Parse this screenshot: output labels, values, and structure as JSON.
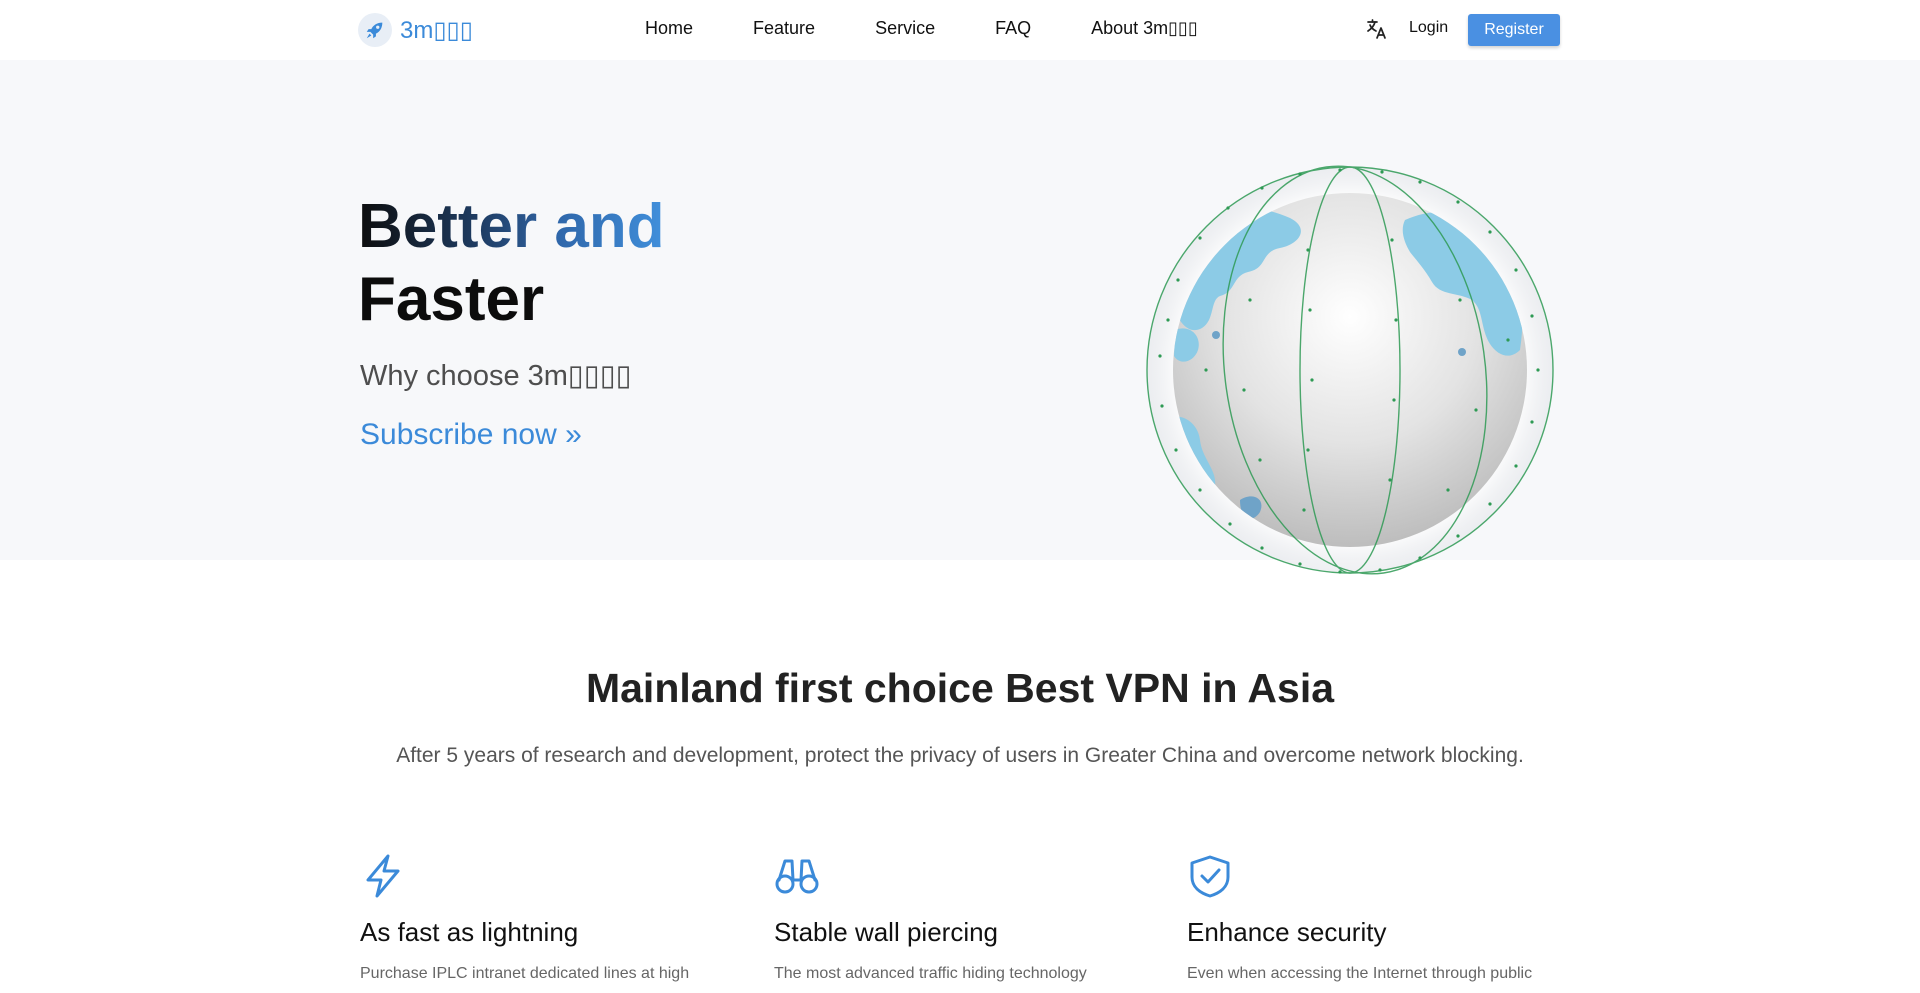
{
  "nav": {
    "brand": "3m▯▯▯",
    "logo_icon": "rocket-icon",
    "items": [
      {
        "label": "Home"
      },
      {
        "label": "Feature"
      },
      {
        "label": "Service"
      },
      {
        "label": "FAQ"
      },
      {
        "label": "About 3m▯▯▯"
      }
    ],
    "translate_icon": "translate-icon",
    "login_label": "Login",
    "register_label": "Register"
  },
  "hero": {
    "title_word1": "Better",
    "title_word2": "and",
    "title_line2": "Faster",
    "subtitle": "Why choose 3m▯▯▯▯",
    "cta_label": "Subscribe now »",
    "image": "globe-illustration"
  },
  "intro": {
    "headline": "Mainland first choice Best VPN in Asia",
    "lead": "After 5 years of research and development, protect the privacy of users in Greater China and overcome network blocking."
  },
  "features": [
    {
      "icon": "lightning-icon",
      "title": "As fast as lightning",
      "text": "Purchase IPLC intranet dedicated lines at high"
    },
    {
      "icon": "binoculars-icon",
      "title": "Stable wall piercing",
      "text": "The most advanced traffic hiding technology"
    },
    {
      "icon": "shield-check-icon",
      "title": "Enhance security",
      "text": "Even when accessing the Internet through public"
    }
  ],
  "colors": {
    "accent": "#3b8ad9",
    "button": "#4a90e2",
    "hero_bg": "#f7f8fa",
    "globe_land": "#8ccbe6",
    "globe_lines": "#2e9a54"
  }
}
